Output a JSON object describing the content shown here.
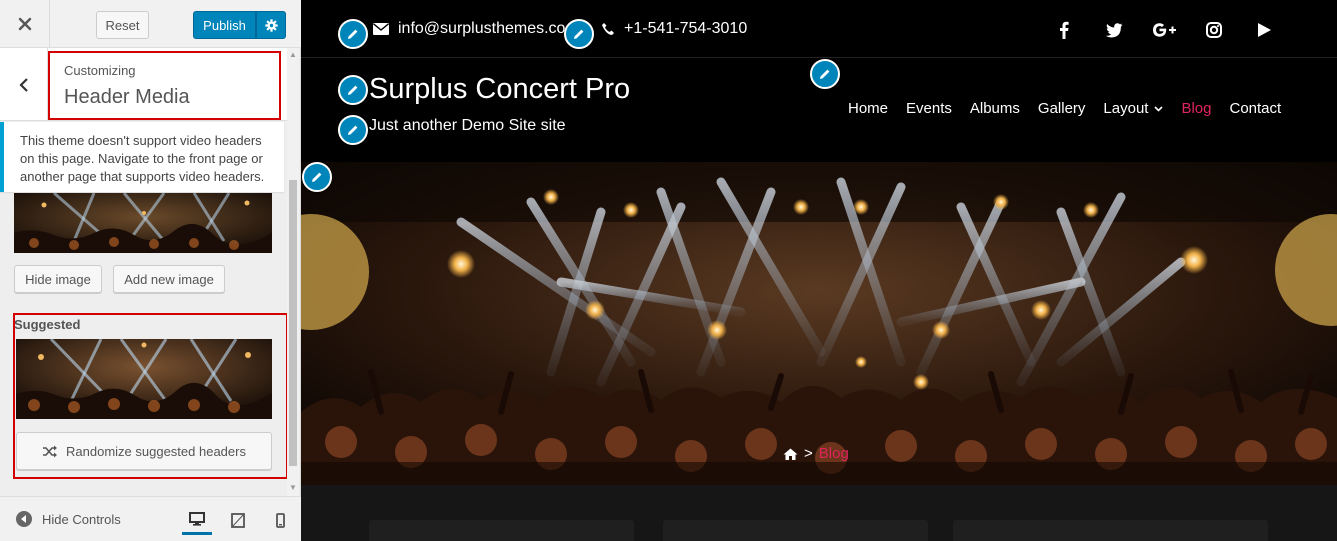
{
  "customizer": {
    "reset_label": "Reset",
    "publish_label": "Publish",
    "customizing_label": "Customizing",
    "section_title": "Header Media",
    "notice_text": "This theme doesn't support video headers on this page. Navigate to the front page or another page that supports video headers.",
    "hide_image_label": "Hide image",
    "add_new_image_label": "Add new image",
    "suggested_label": "Suggested",
    "randomize_label": "Randomize suggested headers",
    "hide_controls_label": "Hide Controls",
    "accent_color": "#0085ba",
    "highlight_color": "#d40000"
  },
  "preview": {
    "email": "info@surplusthemes.co",
    "phone": "+1-541-754-3010",
    "social": [
      "facebook-icon",
      "twitter-icon",
      "google-plus-icon",
      "instagram-icon",
      "youtube-icon"
    ],
    "site_title": "Surplus Concert Pro",
    "tagline": "Just another Demo Site site",
    "nav": {
      "home": "Home",
      "events": "Events",
      "albums": "Albums",
      "gallery": "Gallery",
      "layout": "Layout",
      "blog": "Blog",
      "contact": "Contact"
    },
    "breadcrumb": {
      "separator": ">",
      "current": "Blog"
    },
    "active_color": "#e0245e"
  }
}
